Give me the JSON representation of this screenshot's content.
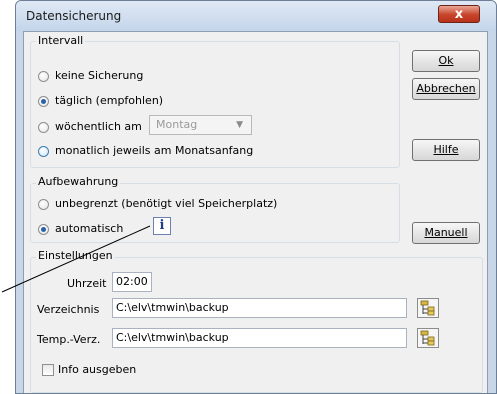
{
  "window": {
    "title": "Datensicherung",
    "close_glyph": "x"
  },
  "intervall": {
    "label": "Intervall",
    "options": [
      {
        "label": "keine Sicherung",
        "selected": false
      },
      {
        "label": "täglich (empfohlen)",
        "selected": true
      },
      {
        "label": "wöchentlich am",
        "selected": false
      },
      {
        "label": "monatlich jeweils am Monatsanfang",
        "selected": false
      }
    ],
    "weekday_value": "Montag"
  },
  "aufbewahrung": {
    "label": "Aufbewahrung",
    "options": [
      {
        "label": "unbegrenzt (benötigt viel Speicherplatz)",
        "selected": false
      },
      {
        "label": "automatisch",
        "selected": true
      }
    ],
    "info_glyph": "i"
  },
  "einstellungen": {
    "label": "Einstellungen",
    "uhrzeit_label": "Uhrzeit",
    "uhrzeit_value": "02:00",
    "verzeichnis_label": "Verzeichnis",
    "verzeichnis_value": "C:\\elv\\tmwin\\backup",
    "temp_label": "Temp.-Verz.",
    "temp_value": "C:\\elv\\tmwin\\backup",
    "info_checkbox_label": "Info ausgeben",
    "info_checked": false
  },
  "buttons": {
    "ok": "Ok",
    "abbrechen": "Abbrechen",
    "hilfe": "Hilfe",
    "manuell": "Manuell"
  },
  "colors": {
    "accent": "#2a61a8",
    "close": "#c7442a"
  }
}
